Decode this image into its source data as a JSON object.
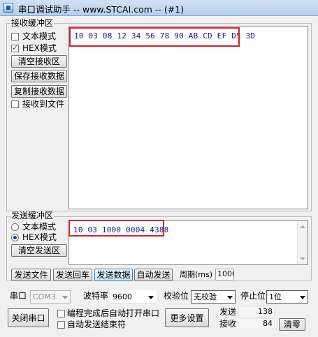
{
  "window": {
    "title": "串口调试助手 -- www.STCAI.com -- (#1)"
  },
  "receive": {
    "group_label": "接收缓冲区",
    "text_mode_label": "文本模式",
    "hex_mode_label": "HEX模式",
    "hex_mode_checked": true,
    "text_mode_checked": false,
    "clear_button": "清空接收区",
    "save_button": "保存接收数据",
    "copy_button": "复制接收数据",
    "to_file_label": "接收到文件",
    "to_file_checked": false,
    "data": "10 03 08 12 34 56 78 90 AB CD EF D5 3D"
  },
  "send": {
    "group_label": "发送缓冲区",
    "text_mode_label": "文本模式",
    "hex_mode_label": "HEX模式",
    "text_mode_selected": false,
    "hex_mode_selected": true,
    "clear_button": "清空发送区",
    "data": "10 03 1000 0004 4388",
    "send_file_button": "发送文件",
    "send_enter_button": "发送回车",
    "send_data_button": "发送数据",
    "auto_send_button": "自动发送",
    "period_label": "周期(ms)",
    "period_value": "1000"
  },
  "settings": {
    "port_label": "串口",
    "port_value": "COM3",
    "baud_label": "波特率",
    "baud_value": "9600",
    "parity_label": "校验位",
    "parity_value": "无校验",
    "stopbits_label": "停止位",
    "stopbits_value": "1位",
    "close_port_button": "关闭串口",
    "auto_open_label": "编程完成后自动打开串口",
    "auto_send_end_label": "自动发送结束符",
    "more_settings_button": "更多设置",
    "sent_label": "发送",
    "sent_count": "138",
    "recv_label": "接收",
    "recv_count": "84",
    "clear_counts_button": "清零"
  },
  "colors": {
    "highlight_box": "#d0242b",
    "data_text": "#1a1a7a"
  }
}
